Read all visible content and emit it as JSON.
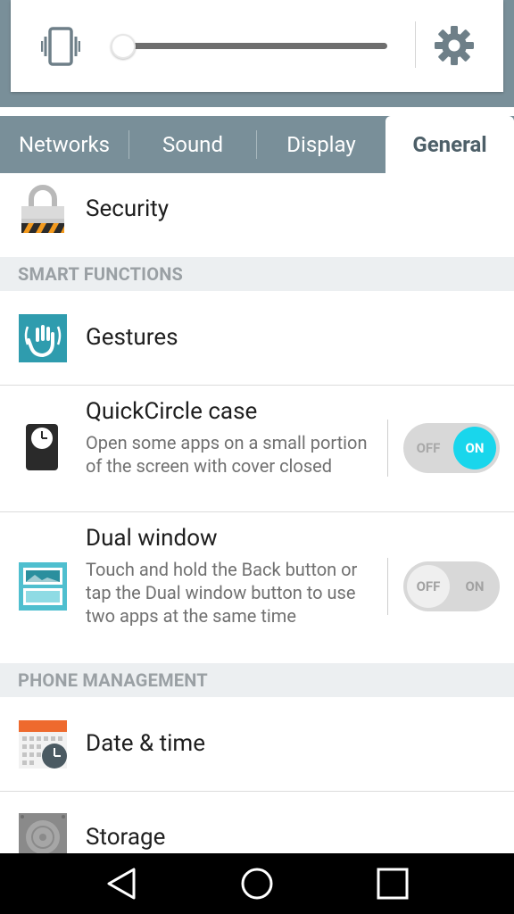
{
  "tabs": [
    {
      "label": "Networks",
      "selected": false
    },
    {
      "label": "Sound",
      "selected": false
    },
    {
      "label": "Display",
      "selected": false
    },
    {
      "label": "General",
      "selected": true
    }
  ],
  "volume": {
    "level": 0.0
  },
  "rows": {
    "security": {
      "title": "Security",
      "icon": "padlock-icon"
    },
    "gestures": {
      "title": "Gestures",
      "icon": "hand-gesture-icon"
    },
    "quickcircle": {
      "title": "QuickCircle case",
      "subtitle": "Open some apps on a small portion of the screen with cover closed",
      "icon": "quickcircle-case-icon",
      "switch": {
        "state": "on",
        "off_label": "OFF",
        "on_label": "ON"
      }
    },
    "dualwindow": {
      "title": "Dual window",
      "subtitle": "Touch and hold the Back button or tap the Dual window button to use two apps at the same time",
      "icon": "dual-window-icon",
      "switch": {
        "state": "off",
        "off_label": "OFF",
        "on_label": "ON"
      }
    },
    "datetime": {
      "title": "Date & time",
      "icon": "calendar-clock-icon"
    },
    "storage": {
      "title": "Storage",
      "icon": "storage-icon"
    }
  },
  "sections": {
    "smart_functions": "SMART FUNCTIONS",
    "phone_management": "PHONE MANAGEMENT"
  },
  "colors": {
    "tab_bar": "#798f99",
    "switch_on": "#19d6ec",
    "header_bg": "#eceff1"
  }
}
